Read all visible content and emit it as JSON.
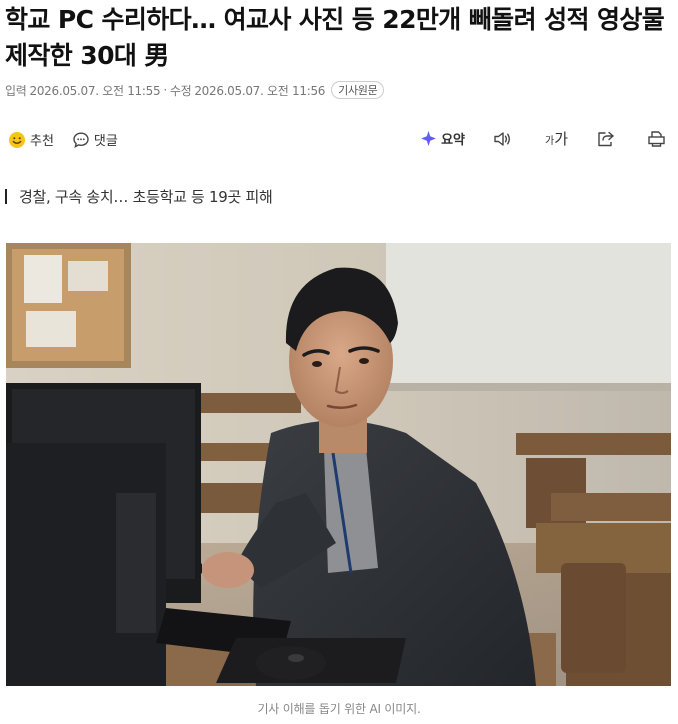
{
  "article": {
    "title": "학교 PC 수리하다… 여교사 사진 등 22만개 빼돌려 성적 영상물 제작한 30대 男",
    "published_label": "입력",
    "published": "2026.05.07. 오전 11:55",
    "separator": "·",
    "modified_label": "수정",
    "modified": "2026.05.07. 오전 11:56",
    "original_badge": "기사원문",
    "subtitle": "경찰, 구속 송치… 초등학교 등 19곳 피해",
    "photo_caption": "기사 이해를 돕기 위한 AI 이미지."
  },
  "toolbar": {
    "recommend": "추천",
    "comments": "댓글",
    "summary": "요약",
    "font_size": "가가"
  },
  "icons": {
    "recommend": "smile-icon",
    "comments": "speech-bubble-icon",
    "summary": "ai-sparkle-icon",
    "audio": "speaker-icon",
    "font_size": "font-size-icon",
    "share": "share-icon",
    "print": "print-icon"
  },
  "colors": {
    "recommend_icon": "#f5c518",
    "summary_icon": "#6a4cf0",
    "summary_icon_alt": "#3a7bf7"
  }
}
